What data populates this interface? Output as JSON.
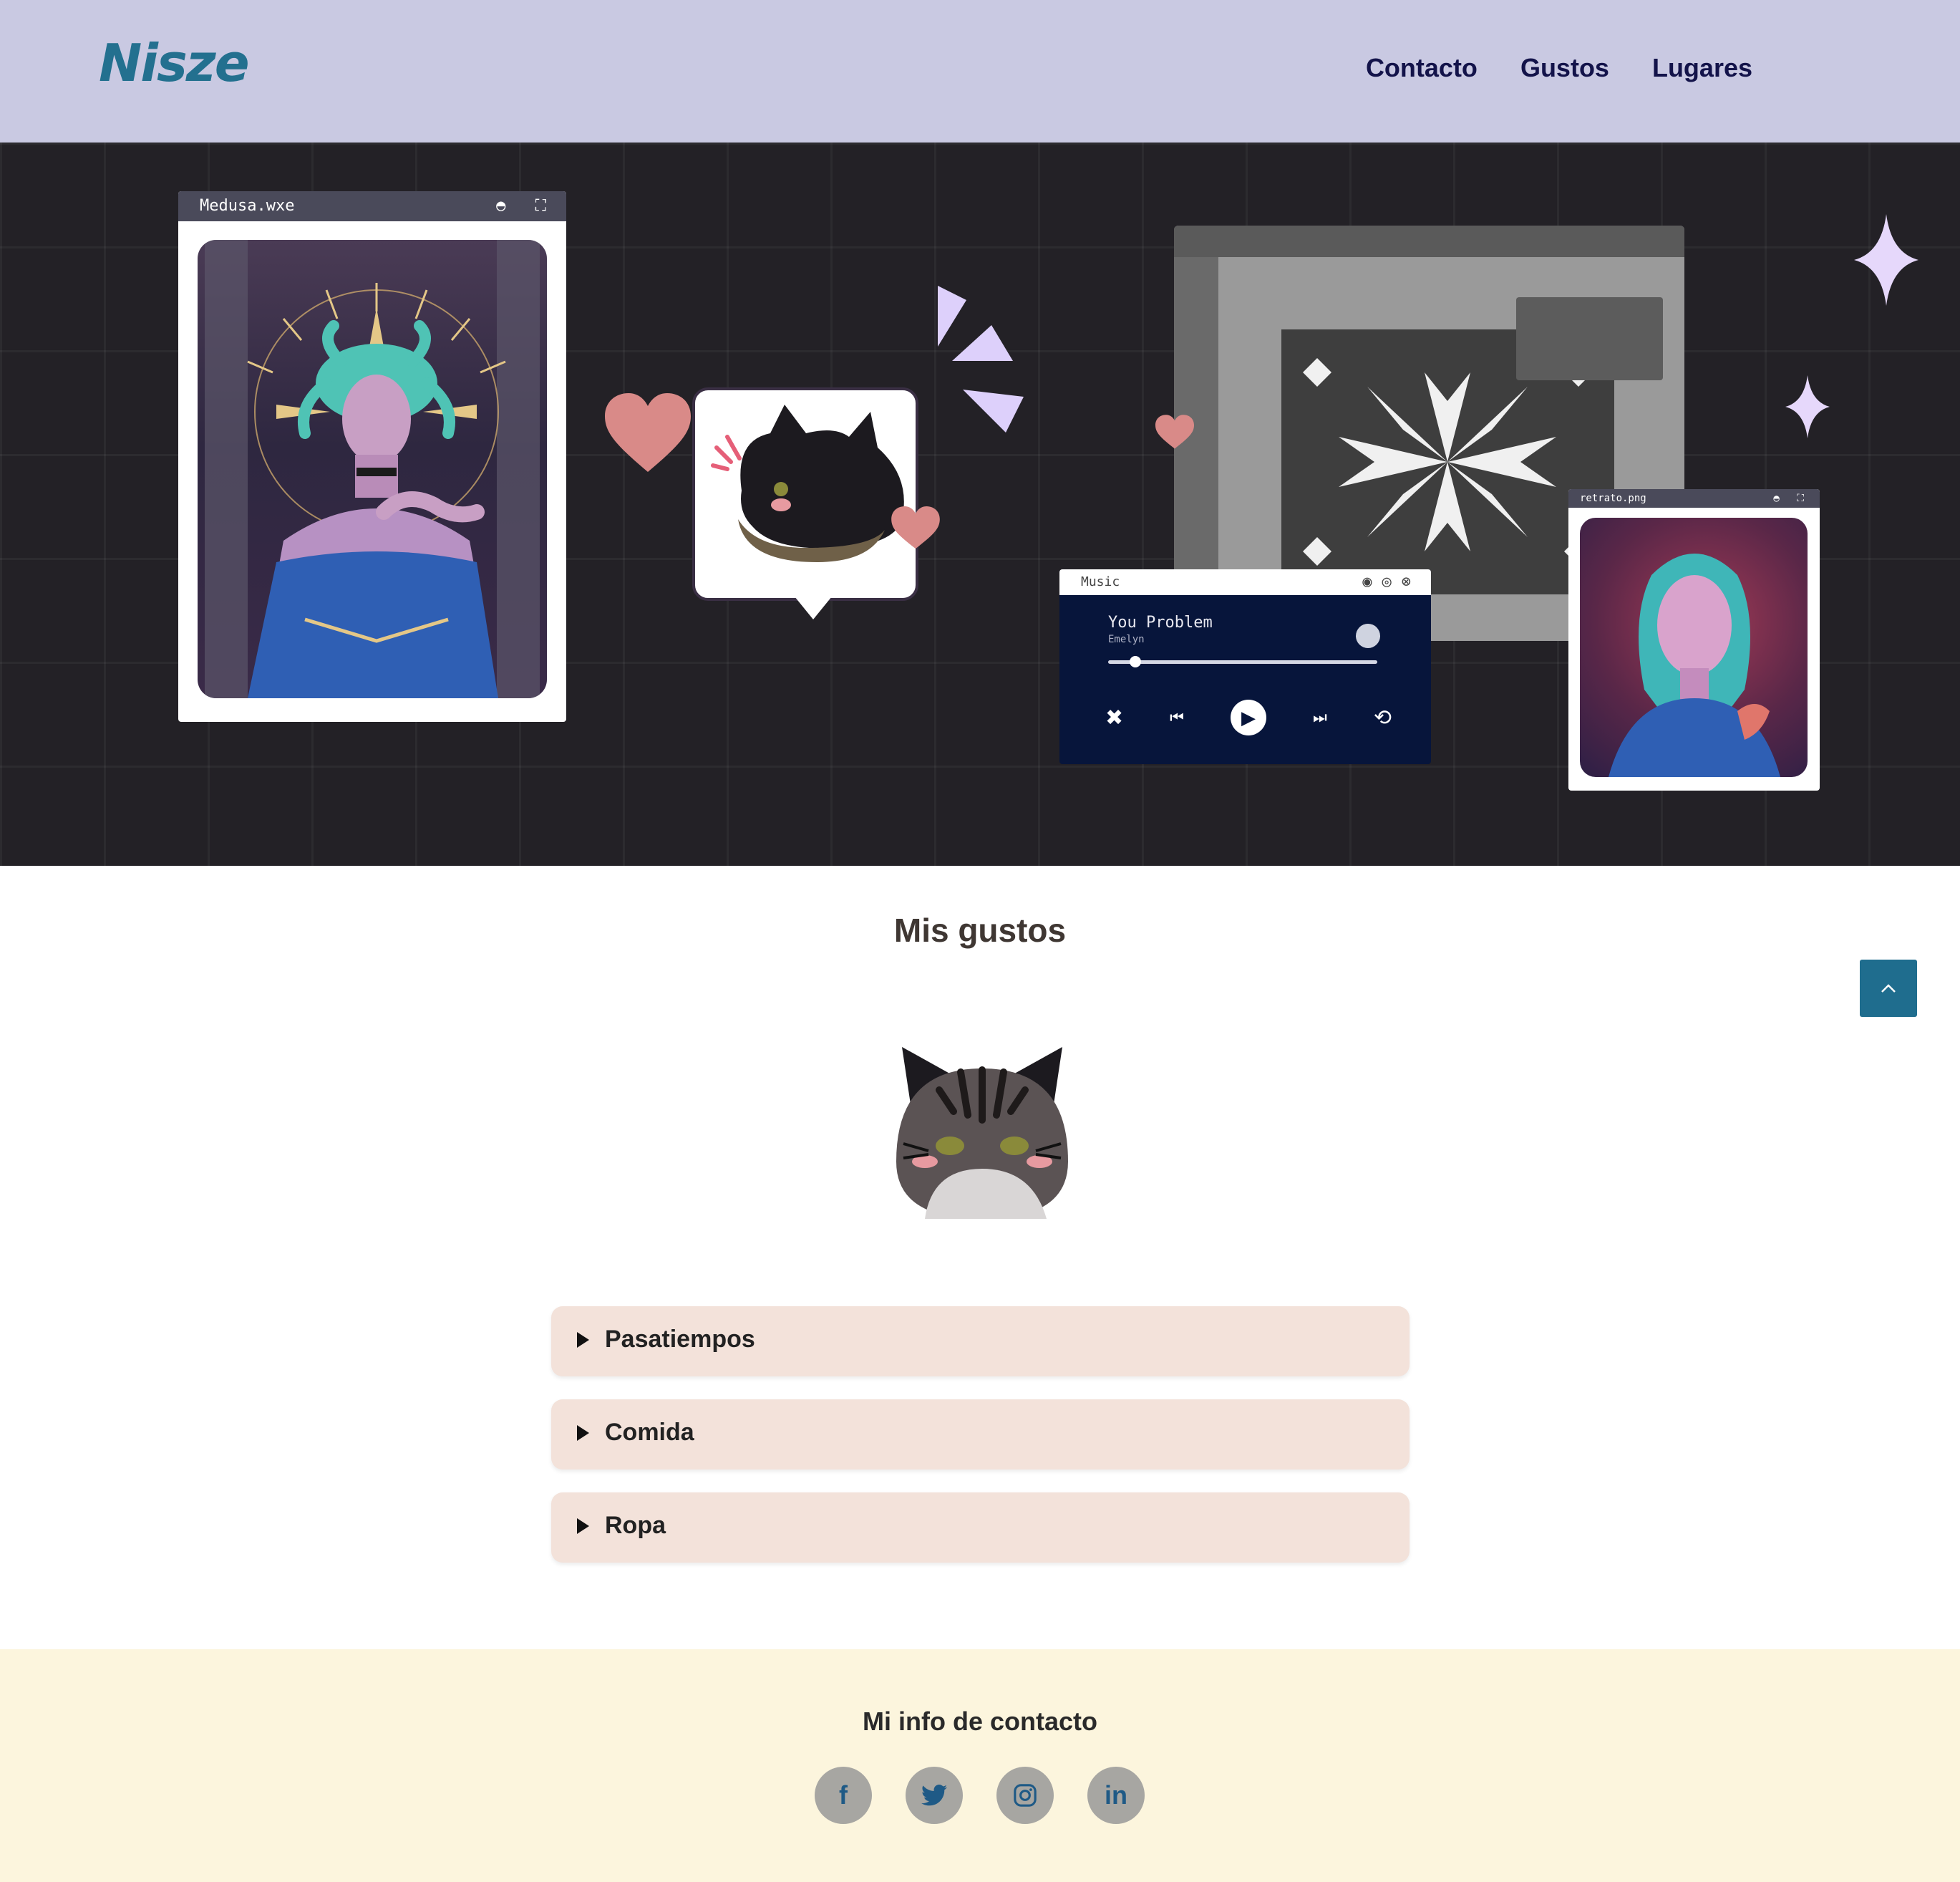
{
  "header": {
    "logo": "Nisze",
    "nav": [
      {
        "label": "Contacto"
      },
      {
        "label": "Gustos"
      },
      {
        "label": "Lugares"
      }
    ]
  },
  "hero": {
    "medusa_window": {
      "title": "Medusa.wxe",
      "controls": "◓ ⛶"
    },
    "editor_window": {
      "icon": "image-editor"
    },
    "music_window": {
      "title": "Music",
      "song": "You Problem",
      "artist": "Emelyn",
      "progress": 0.1,
      "icons": [
        "shuffle-icon",
        "previous-icon",
        "play-icon",
        "next-icon",
        "repeat-icon"
      ]
    },
    "retrato_window": {
      "title": "retrato.png",
      "controls": "◓ ⛶"
    }
  },
  "gustos": {
    "title": "Mis gustos",
    "items": [
      {
        "label": "Pasatiempos"
      },
      {
        "label": "Comida"
      },
      {
        "label": "Ropa"
      }
    ]
  },
  "footer": {
    "title": "Mi info de contacto",
    "socials": [
      {
        "icon": "facebook-icon",
        "glyph": "f"
      },
      {
        "icon": "twitter-icon",
        "glyph": ""
      },
      {
        "icon": "instagram-icon",
        "glyph": ""
      },
      {
        "icon": "linkedin-icon",
        "glyph": "in"
      }
    ]
  },
  "colors": {
    "header_bg": "#c9c9e2",
    "logo": "#23708f",
    "nav_text": "#13134a",
    "hero_bg": "#232126",
    "accordion_bg": "#f3e2da",
    "footer_bg": "#fcf5dd",
    "accent": "#1f6d8e",
    "heart": "#d98a88",
    "sparkle": "#e6d8fb"
  }
}
